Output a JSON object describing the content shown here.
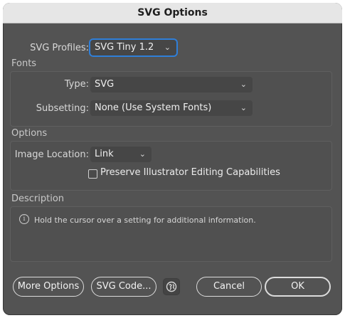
{
  "dialog": {
    "title": "SVG Options"
  },
  "profiles": {
    "label": "SVG Profiles:",
    "value": "SVG Tiny 1.2"
  },
  "fonts": {
    "group_title": "Fonts",
    "type_label": "Type:",
    "type_value": "SVG",
    "subsetting_label": "Subsetting:",
    "subsetting_value": "None (Use System Fonts)"
  },
  "options": {
    "group_title": "Options",
    "image_location_label": "Image Location:",
    "image_location_value": "Link",
    "preserve_label": "Preserve Illustrator Editing Capabilities",
    "preserve_checked": false
  },
  "description": {
    "group_title": "Description",
    "info_glyph": "i",
    "text": "Hold the cursor over a setting for additional information."
  },
  "buttons": {
    "more_options": "More Options",
    "svg_code": "SVG Code...",
    "web_icon": "globe-icon",
    "cancel": "Cancel",
    "ok": "OK"
  },
  "colors": {
    "window_bg": "#535353",
    "titlebar_bg": "#e6e6e6",
    "focus_ring": "#2f7fd9"
  }
}
